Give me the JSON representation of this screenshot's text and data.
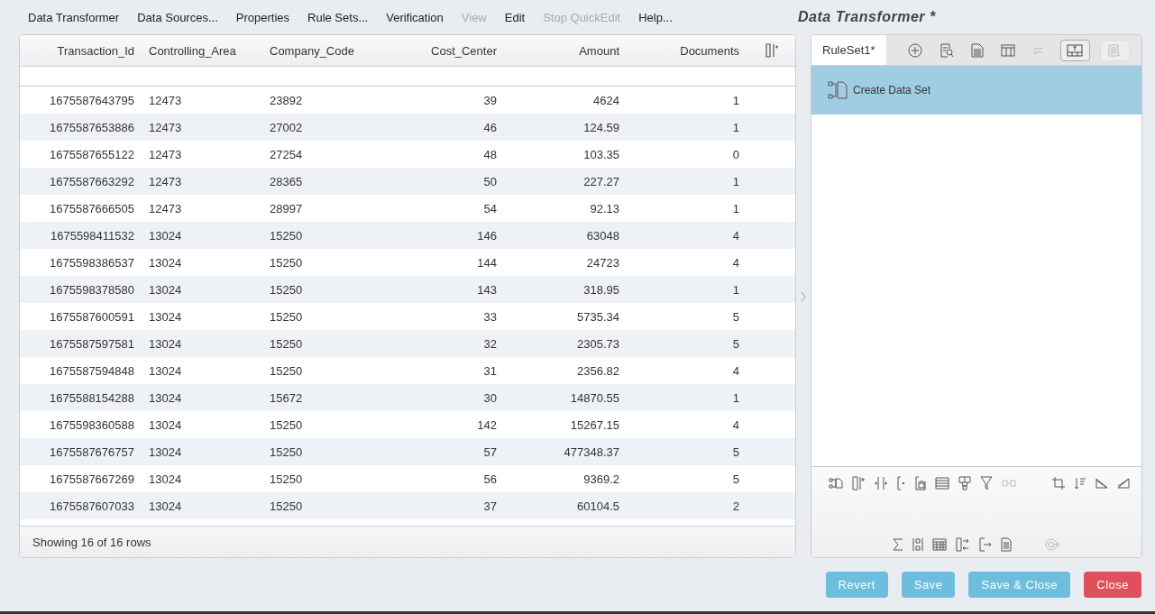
{
  "menu": [
    {
      "label": "Data Transformer",
      "disabled": false
    },
    {
      "label": "Data Sources...",
      "disabled": false
    },
    {
      "label": "Properties",
      "disabled": false
    },
    {
      "label": "Rule Sets...",
      "disabled": false
    },
    {
      "label": "Verification",
      "disabled": false
    },
    {
      "label": "View",
      "disabled": true
    },
    {
      "label": "Edit",
      "disabled": false
    },
    {
      "label": "Stop QuickEdit",
      "disabled": true
    },
    {
      "label": "Help...",
      "disabled": false
    }
  ],
  "window": {
    "title": "Data Transformer *"
  },
  "table": {
    "columns": [
      "Transaction_Id",
      "Controlling_Area",
      "Company_Code",
      "Cost_Center",
      "Amount",
      "Documents"
    ],
    "rows": [
      [
        "1675587643795",
        "12473",
        "23892",
        "39",
        "4624",
        "1"
      ],
      [
        "1675587653886",
        "12473",
        "27002",
        "46",
        "124.59",
        "1"
      ],
      [
        "1675587655122",
        "12473",
        "27254",
        "48",
        "103.35",
        "0"
      ],
      [
        "1675587663292",
        "12473",
        "28365",
        "50",
        "227.27",
        "1"
      ],
      [
        "1675587666505",
        "12473",
        "28997",
        "54",
        "92.13",
        "1"
      ],
      [
        "1675598411532",
        "13024",
        "15250",
        "146",
        "63048",
        "4"
      ],
      [
        "1675598386537",
        "13024",
        "15250",
        "144",
        "24723",
        "4"
      ],
      [
        "1675598378580",
        "13024",
        "15250",
        "143",
        "318.95",
        "1"
      ],
      [
        "1675587600591",
        "13024",
        "15250",
        "33",
        "5735.34",
        "5"
      ],
      [
        "1675587597581",
        "13024",
        "15250",
        "32",
        "2305.73",
        "5"
      ],
      [
        "1675587594848",
        "13024",
        "15250",
        "31",
        "2356.82",
        "4"
      ],
      [
        "1675588154288",
        "13024",
        "15672",
        "30",
        "14870.55",
        "1"
      ],
      [
        "1675598360588",
        "13024",
        "15250",
        "142",
        "15267.15",
        "4"
      ],
      [
        "1675587676757",
        "13024",
        "15250",
        "57",
        "477348.37",
        "5"
      ],
      [
        "1675587667269",
        "13024",
        "15250",
        "56",
        "9369.2",
        "5"
      ],
      [
        "1675587607033",
        "13024",
        "15250",
        "37",
        "60104.5",
        "2"
      ]
    ],
    "footer": "Showing 16 of 16 rows"
  },
  "ruleset": {
    "tabs": [
      {
        "label": "RuleSet1*",
        "selected": true
      }
    ],
    "rules": [
      {
        "label": "Create Data Set",
        "selected": true
      }
    ]
  },
  "buttons": [
    {
      "label": "Revert",
      "kind": "info"
    },
    {
      "label": "Save",
      "kind": "info"
    },
    {
      "label": "Save & Close",
      "kind": "info"
    },
    {
      "label": "Close",
      "kind": "danger"
    }
  ]
}
